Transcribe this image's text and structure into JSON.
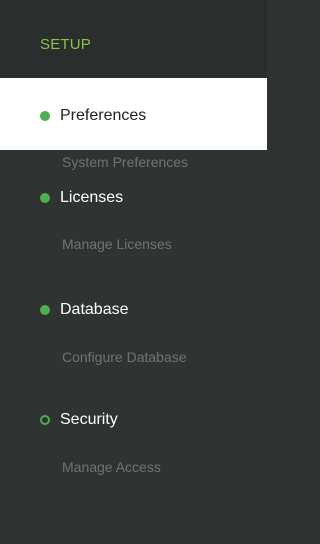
{
  "sidebar": {
    "section_title": "SETUP",
    "accent_color": "#8bc34a",
    "status_color": "#4caf50",
    "items": [
      {
        "label": "Preferences",
        "sublabel": "System Preferences",
        "status_icon": "filled-dot-icon",
        "active": true
      },
      {
        "label": "Licenses",
        "sublabel": "Manage Licenses",
        "status_icon": "filled-dot-icon",
        "active": false
      },
      {
        "label": "Database",
        "sublabel": "Configure Database",
        "status_icon": "filled-dot-icon",
        "active": false
      },
      {
        "label": "Security",
        "sublabel": "Manage Access",
        "status_icon": "hollow-dot-icon",
        "active": false
      }
    ]
  }
}
